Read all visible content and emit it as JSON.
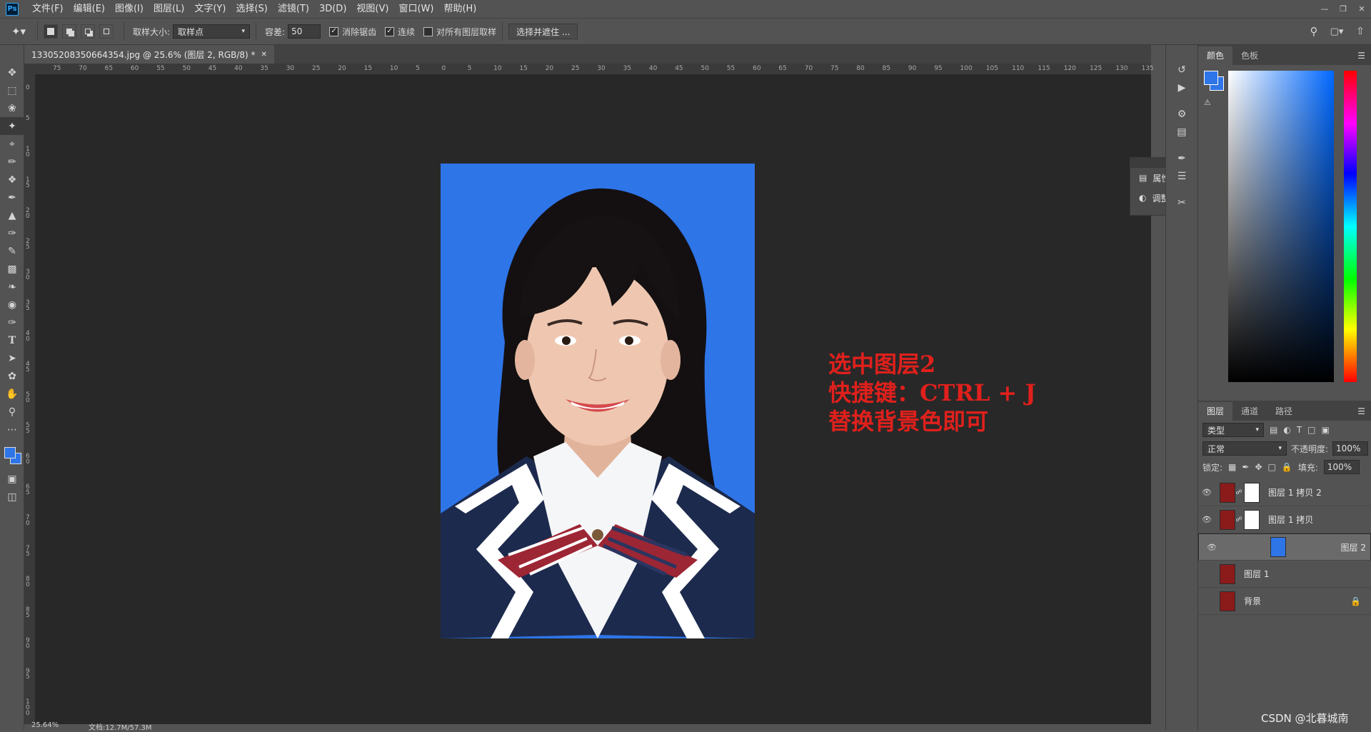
{
  "menubar": {
    "logo": "Ps",
    "items": [
      "文件(F)",
      "编辑(E)",
      "图像(I)",
      "图层(L)",
      "文字(Y)",
      "选择(S)",
      "滤镜(T)",
      "3D(D)",
      "视图(V)",
      "窗口(W)",
      "帮助(H)"
    ]
  },
  "options": {
    "sample_size_label": "取样大小:",
    "sample_size_value": "取样点",
    "tolerance_label": "容差:",
    "tolerance_value": "50",
    "antialias_label": "消除锯齿",
    "contiguous_label": "连续",
    "sample_all_label": "对所有图层取样",
    "select_mask_button": "选择并遮住 ..."
  },
  "document": {
    "tab_title": "1330520835066435​4.jpg @ 25.6% (图层 2, RGB/8) *",
    "status_zoom": "25.64%",
    "status_doc": "文档:12.7M/57.3M"
  },
  "ruler": {
    "h_labels": [
      "75",
      "70",
      "65",
      "60",
      "55",
      "50",
      "45",
      "40",
      "35",
      "30",
      "25",
      "20",
      "15",
      "10",
      "5",
      "0",
      "5",
      "10",
      "15",
      "20",
      "25",
      "30",
      "35",
      "40",
      "45",
      "50",
      "55",
      "60",
      "65",
      "70",
      "75",
      "80",
      "85",
      "90",
      "95",
      "100",
      "105",
      "110",
      "115",
      "120",
      "125",
      "130",
      "135"
    ],
    "v_labels": [
      "0",
      "5",
      "10",
      "15",
      "20",
      "25",
      "30",
      "35",
      "40",
      "45",
      "50",
      "55",
      "60",
      "65",
      "70",
      "75",
      "80",
      "85",
      "90",
      "95",
      "100"
    ]
  },
  "annotation": {
    "line1": "选中图层2",
    "line2": "快捷键：CTRL + J",
    "line3": "替换背景色即可"
  },
  "mini_panel": {
    "properties": "属性",
    "adjustments": "调整"
  },
  "color_panel": {
    "tab_color": "颜色",
    "tab_swatches": "色板",
    "foreground": "#2e75e8",
    "background": "#ffffff"
  },
  "layers_panel": {
    "tab_layers": "图层",
    "tab_channels": "通道",
    "tab_paths": "路径",
    "filter_type": "类型",
    "blend_mode": "正常",
    "opacity_label": "不透明度:",
    "opacity_value": "100%",
    "lock_label": "锁定:",
    "fill_label": "填充:",
    "fill_value": "100%",
    "layers": [
      {
        "name": "图层 1 拷贝 2",
        "visible": true,
        "mask": true,
        "selected": false
      },
      {
        "name": "图层 1 拷贝",
        "visible": true,
        "mask": true,
        "selected": false
      },
      {
        "name": "图层 2",
        "visible": true,
        "mask": false,
        "selected": true
      },
      {
        "name": "图层 1",
        "visible": false,
        "mask": false,
        "selected": false
      },
      {
        "name": "背景",
        "visible": false,
        "mask": false,
        "selected": false
      }
    ]
  },
  "watermark": "CSDN @北暮城南"
}
